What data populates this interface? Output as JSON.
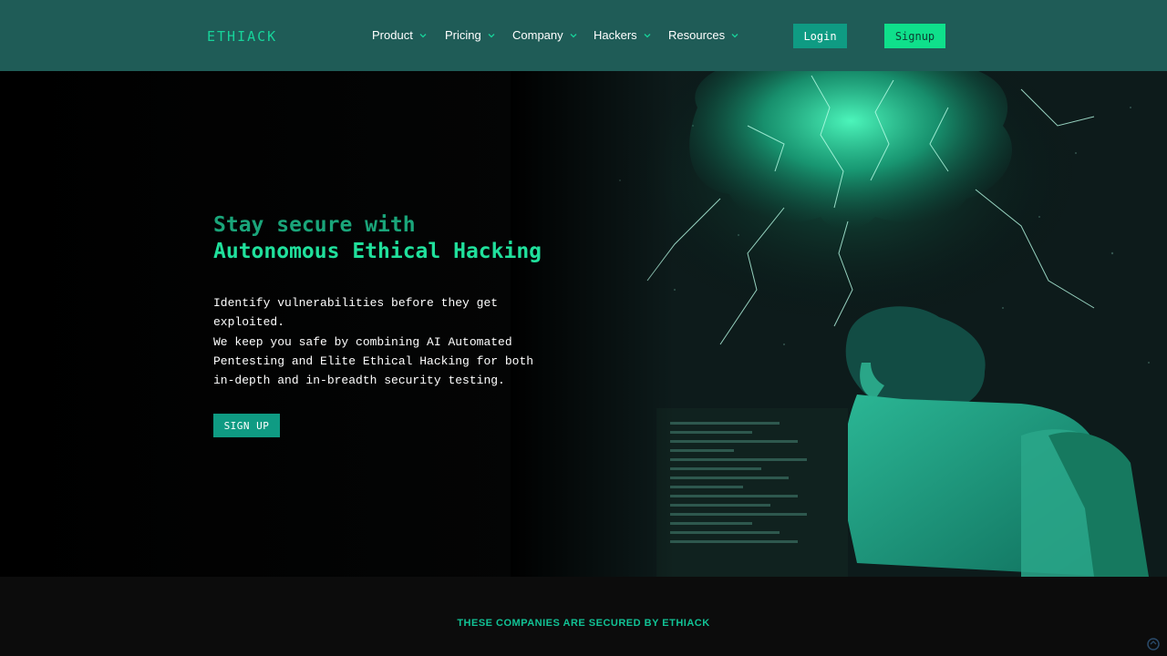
{
  "header": {
    "logo": "ETHIACK",
    "nav": [
      {
        "label": "Product"
      },
      {
        "label": "Pricing"
      },
      {
        "label": "Company"
      },
      {
        "label": "Hackers"
      },
      {
        "label": "Resources"
      }
    ],
    "login_label": "Login",
    "signup_label": "Signup"
  },
  "hero": {
    "title_line1": "Stay secure with",
    "title_line2": "Autonomous Ethical Hacking",
    "paragraph1": "Identify vulnerabilities before they get exploited.",
    "paragraph2": "We keep you safe by combining AI Automated Pentesting and Elite Ethical Hacking for both in-depth and in-breadth security testing.",
    "cta_label": "SIGN UP"
  },
  "band": {
    "text": "THESE COMPANIES ARE SECURED BY ETHIACK"
  },
  "colors": {
    "header_bg": "#1f5c57",
    "accent": "#20e09c",
    "button_teal": "#0f9b83",
    "button_signup": "#0fe08b"
  }
}
